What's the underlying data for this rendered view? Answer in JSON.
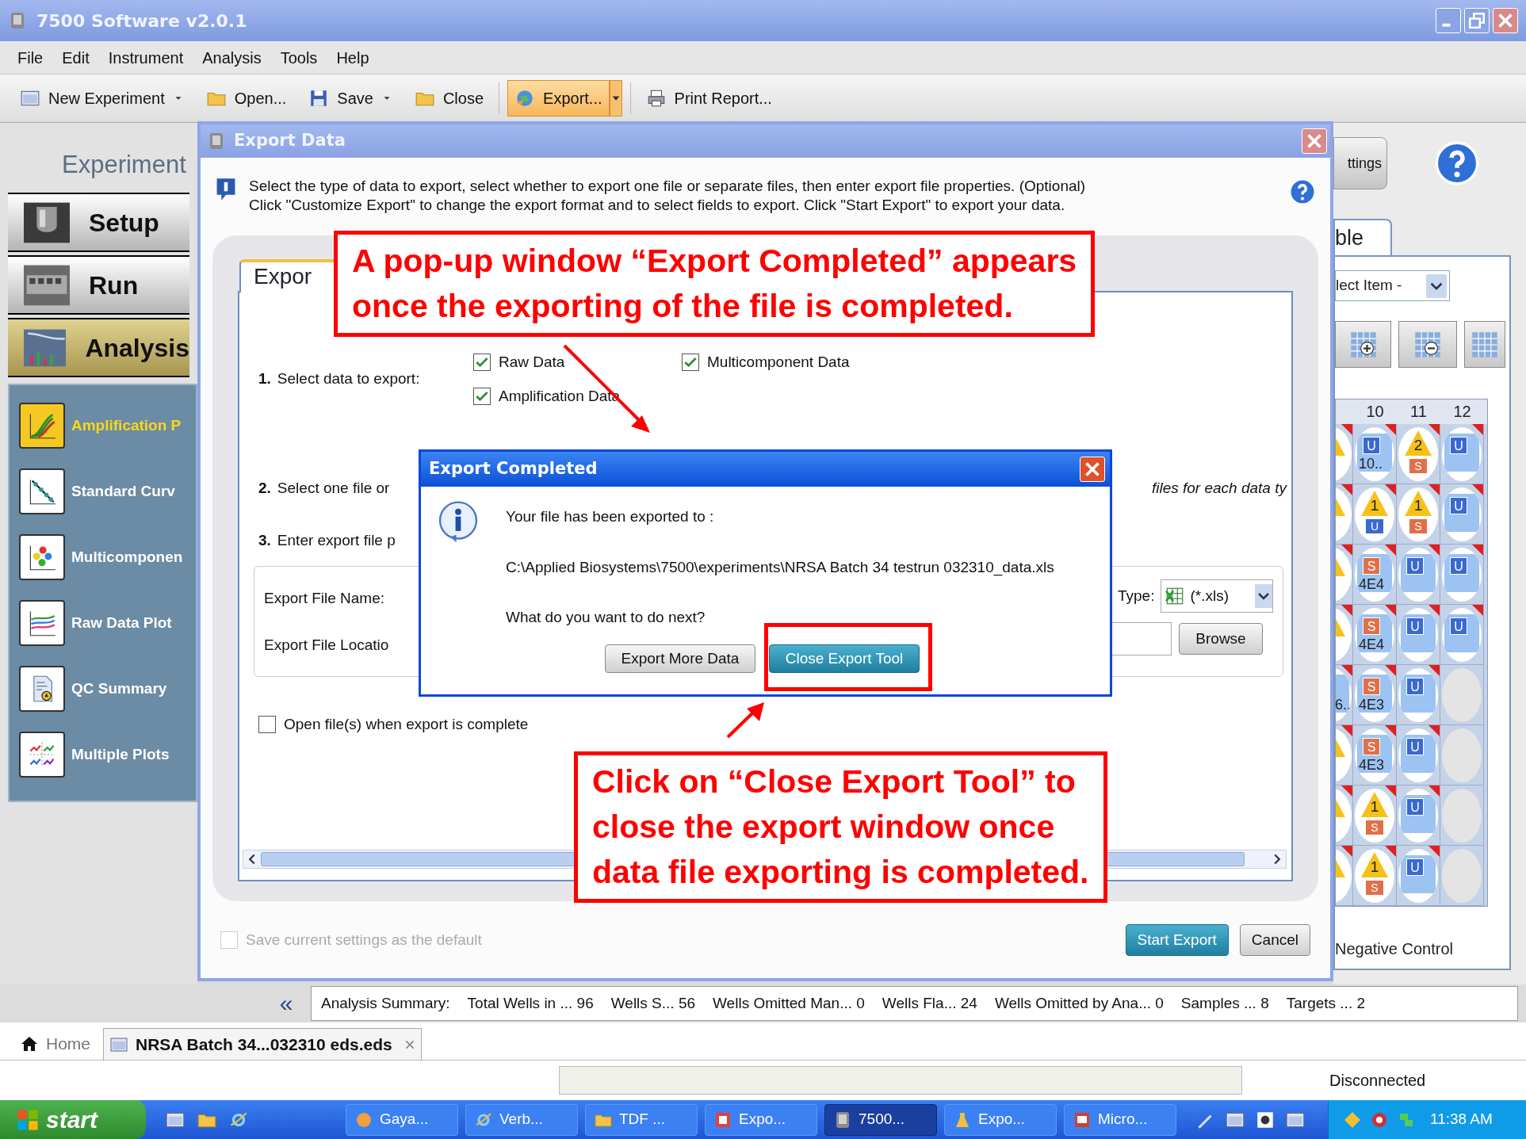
{
  "window": {
    "title": "7500 Software v2.0.1"
  },
  "menu": [
    "File",
    "Edit",
    "Instrument",
    "Analysis",
    "Tools",
    "Help"
  ],
  "toolbar": [
    {
      "label": "New Experiment",
      "kind": "dropdown",
      "selected": false
    },
    {
      "label": "Open...",
      "kind": "button",
      "selected": false
    },
    {
      "label": "Save",
      "kind": "dropdown",
      "selected": false
    },
    {
      "label": "Close",
      "kind": "button",
      "selected": false
    },
    {
      "label": "Export...",
      "kind": "split",
      "selected": true
    },
    {
      "label": "Print Report...",
      "kind": "button",
      "selected": false
    }
  ],
  "sidebar": {
    "header": "Experiment",
    "sections": [
      {
        "label": "Setup",
        "selected": false
      },
      {
        "label": "Run",
        "selected": false
      },
      {
        "label": "Analysis",
        "selected": true
      }
    ],
    "items": [
      {
        "label": "Amplification P",
        "selected": true
      },
      {
        "label": "Standard Curv",
        "selected": false
      },
      {
        "label": "Multicomponen",
        "selected": false
      },
      {
        "label": "Raw Data Plot",
        "selected": false
      },
      {
        "label": "QC Summary",
        "selected": false
      },
      {
        "label": "Multiple Plots",
        "selected": false
      }
    ]
  },
  "right_panel": {
    "settings_button": "ttings",
    "tab": "ble",
    "item_select": "lect Item -",
    "plate": {
      "columns": [
        "",
        "10",
        "11",
        "12"
      ],
      "rows": [
        [
          {
            "kind": "target"
          },
          {
            "kind": "unknown",
            "badge": "U",
            "value": "10.."
          },
          {
            "kind": "target",
            "value": "2",
            "badge": "S"
          },
          {
            "kind": "unknown",
            "badge": "U"
          }
        ],
        [
          {
            "kind": "target"
          },
          {
            "kind": "target",
            "value": "1",
            "badge": "U"
          },
          {
            "kind": "target",
            "value": "1",
            "badge": "S"
          },
          {
            "kind": "unknown",
            "badge": "U"
          }
        ],
        [
          {
            "kind": "target"
          },
          {
            "kind": "standard",
            "badge": "S",
            "value": "4E4"
          },
          {
            "kind": "unknown",
            "badge": "U"
          },
          {
            "kind": "unknown",
            "badge": "U"
          }
        ],
        [
          {
            "kind": "target"
          },
          {
            "kind": "standard",
            "badge": "S",
            "value": "4E4"
          },
          {
            "kind": "unknown",
            "badge": "U"
          },
          {
            "kind": "unknown",
            "badge": "U"
          }
        ],
        [
          {
            "kind": "unknown",
            "value": "6.."
          },
          {
            "kind": "standard",
            "badge": "S",
            "value": "4E3"
          },
          {
            "kind": "unknown",
            "badge": "U"
          },
          {
            "kind": "empty"
          }
        ],
        [
          {
            "kind": "target"
          },
          {
            "kind": "standard",
            "badge": "S",
            "value": "4E3"
          },
          {
            "kind": "unknown",
            "badge": "U"
          },
          {
            "kind": "empty"
          }
        ],
        [
          {
            "kind": "target"
          },
          {
            "kind": "target",
            "value": "1",
            "badge": "S"
          },
          {
            "kind": "unknown",
            "badge": "U"
          },
          {
            "kind": "empty"
          }
        ],
        [
          {
            "kind": "target"
          },
          {
            "kind": "target",
            "value": "1",
            "badge": "S"
          },
          {
            "kind": "unknown",
            "badge": "U"
          },
          {
            "kind": "empty"
          }
        ]
      ]
    },
    "legend": "Negative Control"
  },
  "export_dialog": {
    "title": "Export Data",
    "info": "Select the type of data to export, select whether to export one file or separate files, then enter export file properties. (Optional)\nClick \"Customize Export\" to change the export format and to select fields to export. Click \"Start Export\" to export your data.",
    "tab": "Expor",
    "step_1": {
      "number": "1.",
      "label": "Select data to export:",
      "options": [
        {
          "label": "Raw Data",
          "checked": true
        },
        {
          "label": "Multicomponent Data",
          "checked": true
        },
        {
          "label": "Amplification Data",
          "checked": true
        }
      ]
    },
    "step_2": {
      "number": "2.",
      "label": "Select one file or",
      "trailing": "files for each data ty"
    },
    "step_3": {
      "number": "3.",
      "label": "Enter export file p"
    },
    "file_name_label": "Export File Name:",
    "file_location_label": "Export File Locatio",
    "type_label": "Type:",
    "type_value": "(*.xls)",
    "browse": "Browse",
    "open_when_complete": {
      "label": "Open file(s) when export is complete",
      "checked": false
    },
    "save_default": {
      "label": "Save current settings as the default",
      "checked": false,
      "disabled": true
    },
    "buttons": [
      {
        "label": "Start Export",
        "selected": true
      },
      {
        "label": "Cancel",
        "selected": false
      }
    ]
  },
  "popup": {
    "title": "Export Completed",
    "message": "Your file has been exported to :",
    "path": "C:\\Applied Biosystems\\7500\\experiments\\NRSA Batch 34 testrun 032310_data.xls",
    "question": "What do you want to do next?",
    "buttons": [
      {
        "label": "Export More Data",
        "selected": false
      },
      {
        "label": "Close Export Tool",
        "selected": true
      }
    ]
  },
  "annotations": [
    {
      "kind": "callout",
      "text": "A pop-up window “Export Completed” appears\nonce the exporting of the file is completed."
    },
    {
      "kind": "callout",
      "text": "Click on “Close Export Tool” to\nclose the export window once\ndata file exporting is completed."
    }
  ],
  "summary": {
    "collapse": "«",
    "label": "Analysis Summary:",
    "items": [
      "Total Wells in ... 96",
      "Wells S... 56",
      "Wells Omitted Man... 0",
      "Wells Fla... 24",
      "Wells Omitted by Ana... 0",
      "Samples ... 8",
      "Targets ... 2"
    ]
  },
  "tabs": [
    {
      "label": "Home",
      "selected": false,
      "closable": false
    },
    {
      "label": "NRSA Batch 34...032310 eds.eds",
      "selected": true,
      "closable": true
    }
  ],
  "status_bar": {
    "status": "Disconnected"
  },
  "taskbar": {
    "start": "start",
    "tasks": [
      {
        "label": "Gaya...",
        "selected": false
      },
      {
        "label": "Verb...",
        "selected": false
      },
      {
        "label": "TDF ...",
        "selected": false
      },
      {
        "label": "Expo...",
        "selected": false
      },
      {
        "label": "7500...",
        "selected": true
      },
      {
        "label": "Expo...",
        "selected": false
      },
      {
        "label": "Micro...",
        "selected": false
      }
    ],
    "clock": "11:38 AM"
  }
}
